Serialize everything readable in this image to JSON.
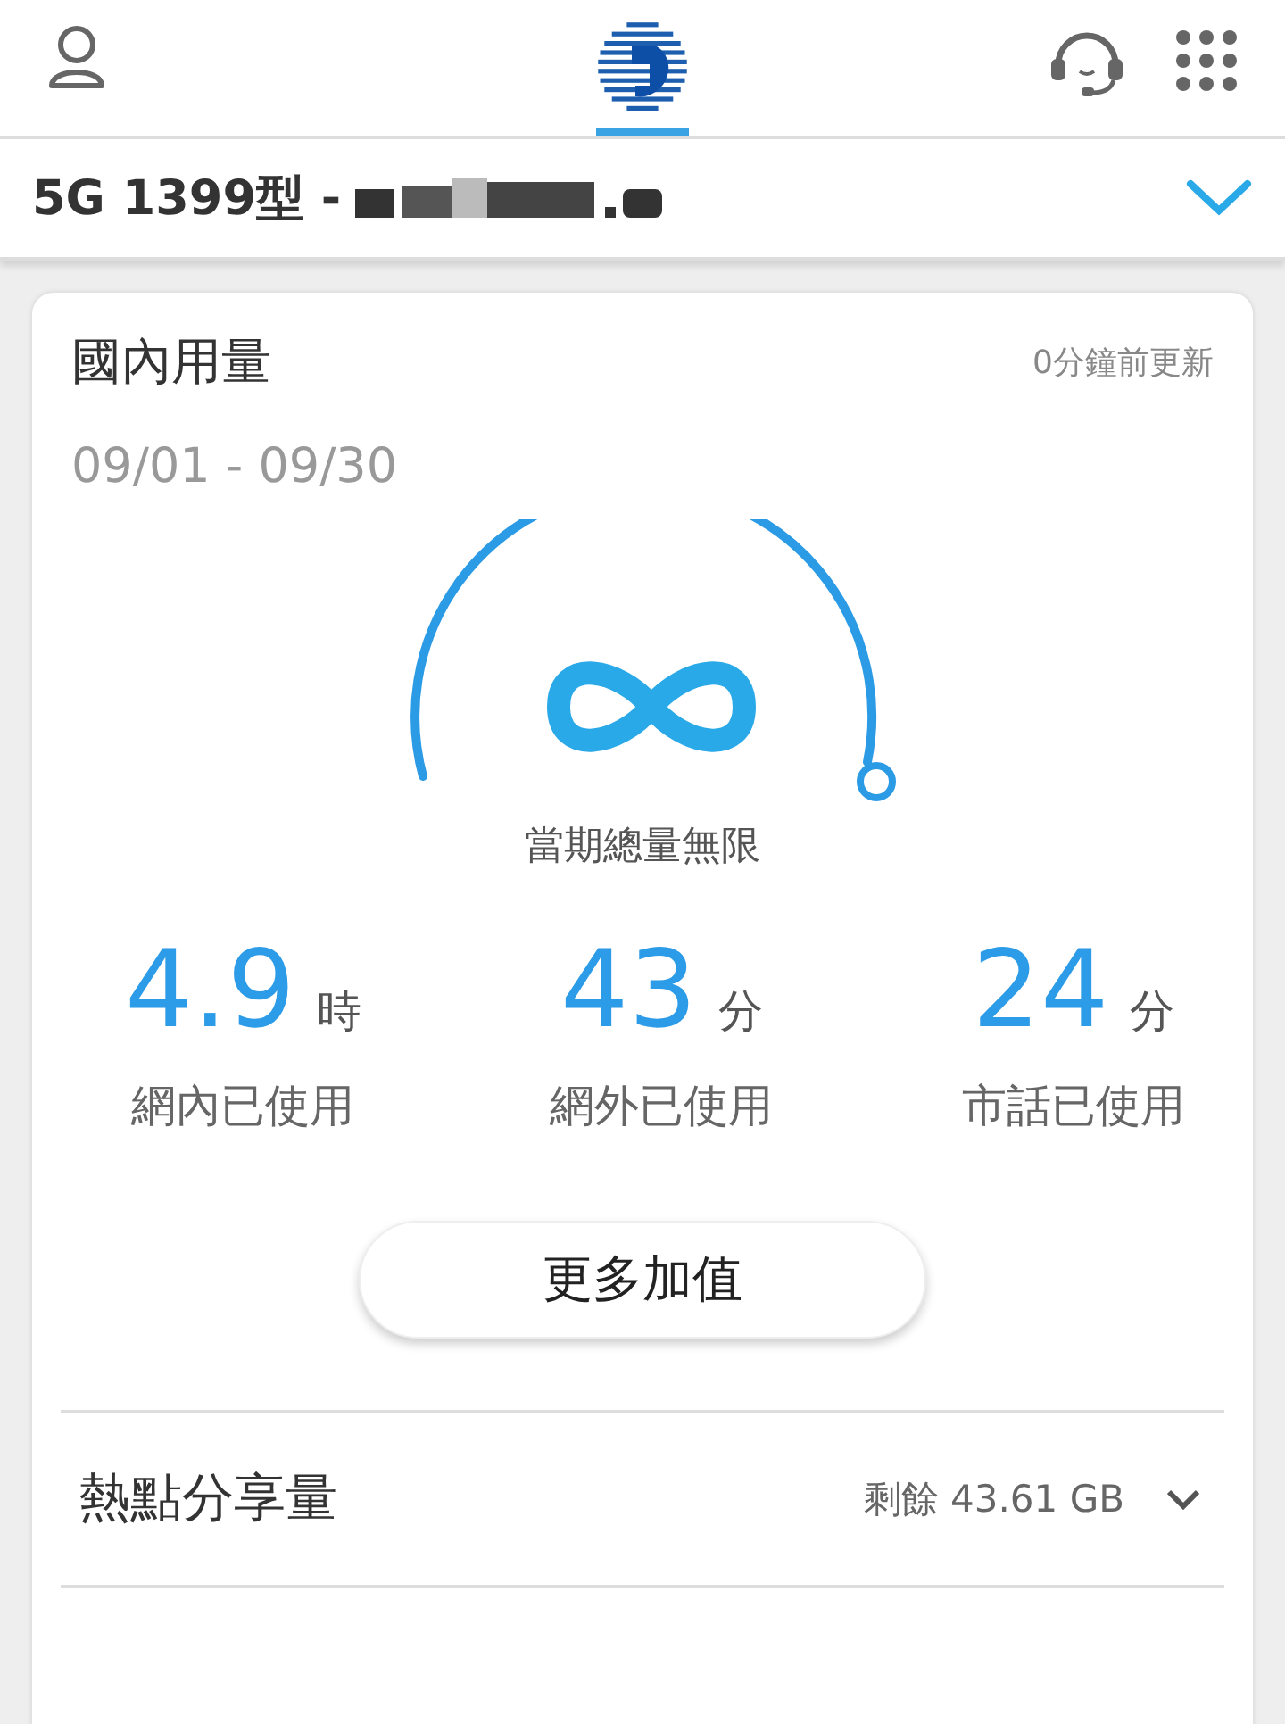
{
  "header": {
    "tabs": [
      {
        "kind": "person",
        "selected": false
      },
      {
        "kind": "logo",
        "selected": true
      },
      {
        "kind": "headset",
        "selected": false
      },
      {
        "kind": "apps",
        "selected": false
      }
    ]
  },
  "plan": {
    "title": "5G 1399型 -",
    "redacted": true
  },
  "usage": {
    "title": "國內用量",
    "updated": "0分鐘前更新",
    "period": "09/01 - 09/30",
    "gauge_label": "當期總量無限",
    "stats": [
      {
        "value": "4.9",
        "unit": "時",
        "label": "網內已使用"
      },
      {
        "value": "43",
        "unit": "分",
        "label": "網外已使用"
      },
      {
        "value": "24",
        "unit": "分",
        "label": "市話已使用"
      }
    ],
    "button": "更多加值"
  },
  "hotspot": {
    "title": "熱點分享量",
    "remaining": "剩餘 43.61 GB",
    "expanded": false
  }
}
